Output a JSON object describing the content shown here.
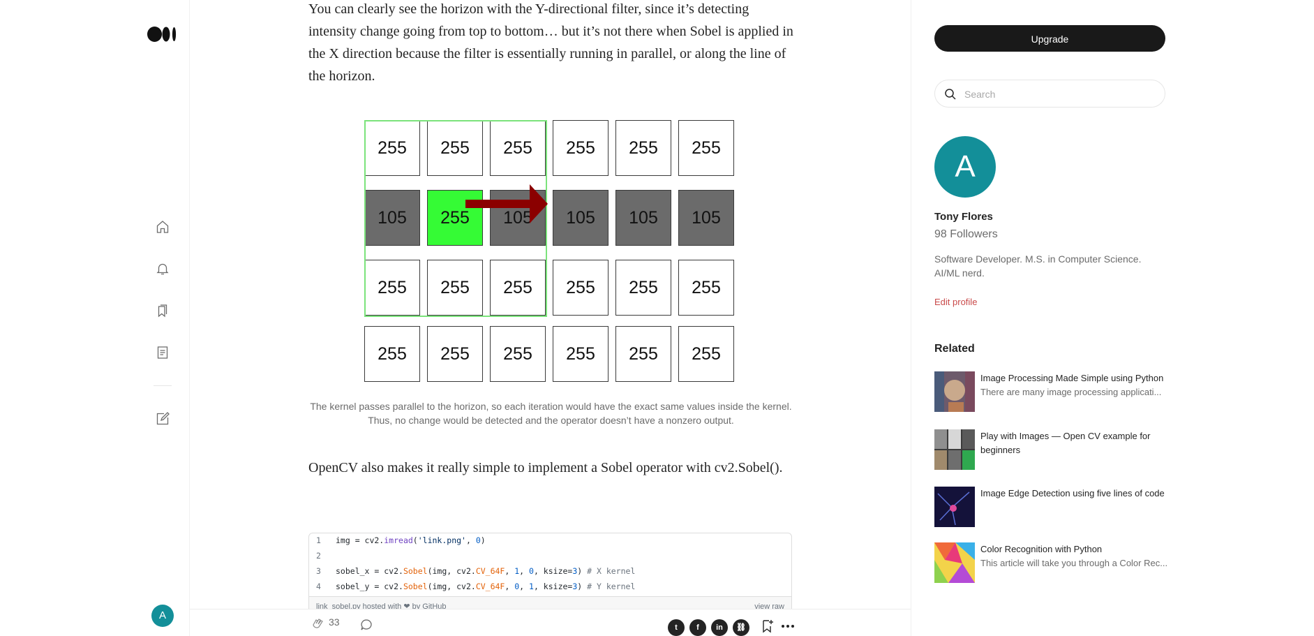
{
  "article": {
    "intro_paragraph": "You can clearly see the horizon with the Y-directional filter, since it’s detecting intensity change going from top to bottom… but it’s not there when Sobel is applied in the X direction because the filter is essentially running in parallel, or along the line of the horizon.",
    "grid": {
      "rows": [
        [
          "255",
          "255",
          "255",
          "255",
          "255",
          "255"
        ],
        [
          "105",
          "255",
          "105",
          "105",
          "105",
          "105"
        ],
        [
          "255",
          "255",
          "255",
          "255",
          "255",
          "255"
        ],
        [
          "255",
          "255",
          "255",
          "255",
          "255",
          "255"
        ]
      ],
      "highlight_color": "#35fb35",
      "kernel_color": "#7be37b",
      "arrow_color": "#8b0000"
    },
    "caption_line1": "The kernel passes parallel to the horizon, so each iteration would have the exact same values inside the kernel.",
    "caption_line2": "Thus, no change would be detected and the operator doesn’t have a nonzero output.",
    "opencv_paragraph": "OpenCV also makes it really simple to implement a Sobel operator with cv2.Sobel().",
    "gist": {
      "line_numbers": [
        "1",
        "2",
        "3",
        "4"
      ],
      "meta_left": "link_sobel.py hosted with ❤ by GitHub",
      "meta_right": "view raw"
    }
  },
  "action_bar": {
    "clap_count": "33",
    "share_labels": [
      "t",
      "f",
      "in",
      "⛓"
    ]
  },
  "sidebar": {
    "upgrade_label": "Upgrade",
    "search_placeholder": "Search",
    "avatar_letter": "A",
    "profile_name": "Tony Flores",
    "followers": "98 Followers",
    "bio": "Software Developer. M.S. in Computer Science. AI/ML nerd.",
    "edit_profile": "Edit profile",
    "related_heading": "Related",
    "related": [
      {
        "title": "Image Processing Made Simple using Python",
        "subtitle": "There are many image processing applicati..."
      },
      {
        "title": "Play with Images — Open CV example for beginners",
        "subtitle": ""
      },
      {
        "title": "Image Edge Detection using five lines of code",
        "subtitle": ""
      },
      {
        "title": "Color Recognition with Python",
        "subtitle": "This article will take you through a Color Rec..."
      }
    ]
  },
  "nav": {
    "avatar_letter": "A",
    "icons": [
      "home-icon",
      "bell-icon",
      "bookmarks-icon",
      "stories-icon",
      "write-icon"
    ]
  },
  "colors": {
    "accent_avatar": "#138f99",
    "upgrade_button": "#191919",
    "edit_profile": "#c94a4a"
  }
}
